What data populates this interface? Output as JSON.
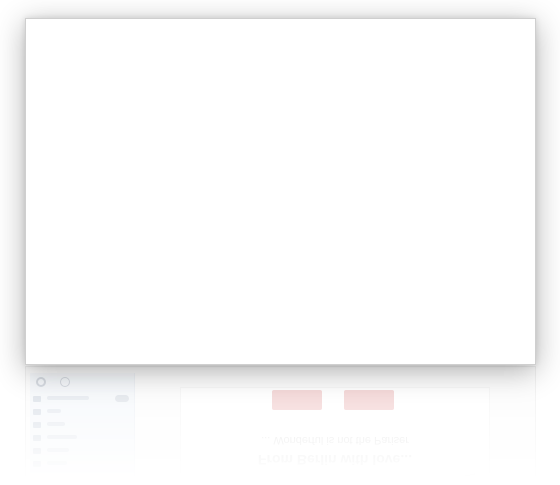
{
  "window": {
    "title": ""
  },
  "reflection": {
    "caption_line1": "... Wonderful is not the Pariser",
    "caption_line2": "From Berlin with love...",
    "sidebar_items": [
      {
        "icon": "folder-icon"
      },
      {
        "icon": "folder-icon"
      },
      {
        "icon": "folder-icon"
      },
      {
        "icon": "folder-icon"
      },
      {
        "icon": "folder-icon"
      },
      {
        "icon": "folder-icon"
      }
    ]
  },
  "colors": {
    "window_bg": "#ffffff",
    "window_border": "#cfcfcf",
    "sidebar_bg": "#edf2f8",
    "banner_accent": "#e7a8a8"
  }
}
